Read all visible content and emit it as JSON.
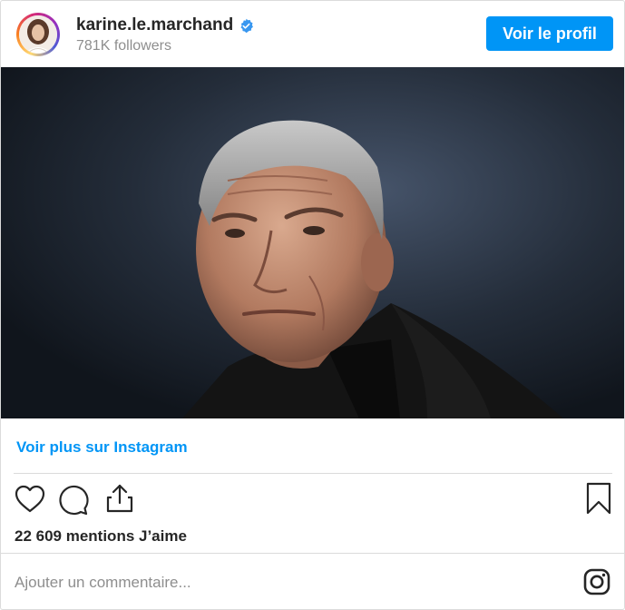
{
  "header": {
    "username": "karine.le.marchand",
    "followers": "781K followers",
    "profile_button": "Voir le profil",
    "verified_icon": "verified-badge-icon"
  },
  "post": {
    "image_alt": "Portrait photo",
    "more_link": "Voir plus sur Instagram"
  },
  "actions": {
    "like_icon": "heart-icon",
    "comment_icon": "comment-icon",
    "share_icon": "share-icon",
    "save_icon": "bookmark-icon"
  },
  "likes_text": "22 609 mentions J’aime",
  "comment": {
    "placeholder": "Ajouter un commentaire..."
  },
  "footer": {
    "logo_icon": "instagram-icon"
  },
  "colors": {
    "accent": "#0095f6",
    "text": "#262626",
    "muted": "#8e8e8e",
    "border": "#dbdbdb"
  }
}
